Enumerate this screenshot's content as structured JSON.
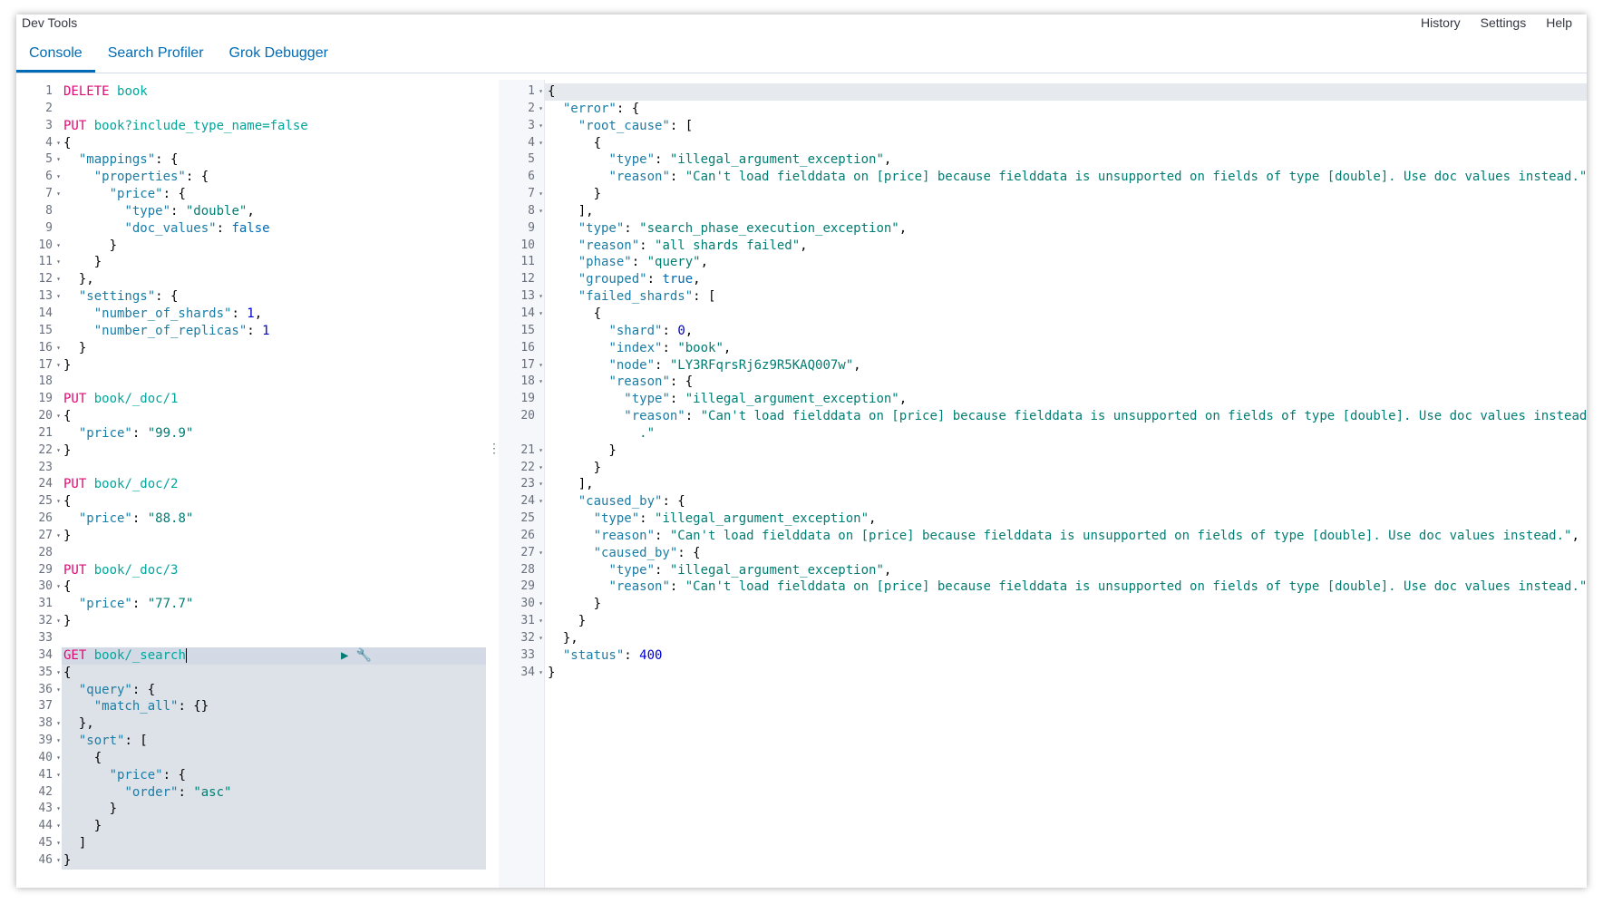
{
  "app_title": "Dev Tools",
  "top_links": [
    "History",
    "Settings",
    "Help"
  ],
  "tabs": [
    {
      "label": "Console",
      "active": true
    },
    {
      "label": "Search Profiler",
      "active": false
    },
    {
      "label": "Grok Debugger",
      "active": false
    }
  ],
  "colors": {
    "accent": "#006bb4",
    "method": "#dd0a73",
    "url": "#00a69b"
  },
  "editor": {
    "lines": [
      "DELETE book",
      "",
      "PUT book?include_type_name=false",
      "{",
      "  \"mappings\": {",
      "    \"properties\": {",
      "      \"price\": {",
      "        \"type\": \"double\",",
      "        \"doc_values\": false",
      "      }",
      "    }",
      "  },",
      "  \"settings\": {",
      "    \"number_of_shards\": 1,",
      "    \"number_of_replicas\": 1",
      "  }",
      "}",
      "",
      "PUT book/_doc/1",
      "{",
      "  \"price\": \"99.9\"",
      "}",
      "",
      "PUT book/_doc/2",
      "{",
      "  \"price\": \"88.8\"",
      "}",
      "",
      "PUT book/_doc/3",
      "{",
      "  \"price\": \"77.7\"",
      "}",
      "",
      "GET book/_search",
      "{",
      "  \"query\": {",
      "    \"match_all\": {}",
      "  },",
      "  \"sort\": [",
      "    {",
      "      \"price\": {",
      "        \"order\": \"asc\"",
      "      }",
      "    }",
      "  ]",
      "}"
    ],
    "fold_lines": [
      4,
      5,
      6,
      7,
      10,
      11,
      12,
      13,
      16,
      17,
      20,
      22,
      25,
      27,
      30,
      32,
      35,
      36,
      38,
      39,
      40,
      41,
      43,
      44,
      45,
      46
    ],
    "active_line": 34,
    "selected_range": [
      34,
      46
    ]
  },
  "output": {
    "lines": [
      "{",
      "  \"error\": {",
      "    \"root_cause\": [",
      "      {",
      "        \"type\": \"illegal_argument_exception\",",
      "        \"reason\": \"Can't load fielddata on [price] because fielddata is unsupported on fields of type [double]. Use doc values instead.\"",
      "      }",
      "    ],",
      "    \"type\": \"search_phase_execution_exception\",",
      "    \"reason\": \"all shards failed\",",
      "    \"phase\": \"query\",",
      "    \"grouped\": true,",
      "    \"failed_shards\": [",
      "      {",
      "        \"shard\": 0,",
      "        \"index\": \"book\",",
      "        \"node\": \"LY3RFqrsRj6z9R5KAQ007w\",",
      "        \"reason\": {",
      "          \"type\": \"illegal_argument_exception\",",
      "          \"reason\": \"Can't load fielddata on [price] because fielddata is unsupported on fields of type [double]. Use doc values instead",
      "        }",
      "      }",
      "    ],",
      "    \"caused_by\": {",
      "      \"type\": \"illegal_argument_exception\",",
      "      \"reason\": \"Can't load fielddata on [price] because fielddata is unsupported on fields of type [double]. Use doc values instead.\",",
      "      \"caused_by\": {",
      "        \"type\": \"illegal_argument_exception\",",
      "        \"reason\": \"Can't load fielddata on [price] because fielddata is unsupported on fields of type [double]. Use doc values instead.\"",
      "      }",
      "    }",
      "  },",
      "  \"status\": 400",
      "}"
    ],
    "wrap_after_line": 20,
    "wrap_text": "            .\"",
    "fold_lines": [
      1,
      2,
      3,
      4,
      7,
      8,
      13,
      14,
      17,
      18,
      21,
      22,
      23,
      24,
      27,
      30,
      31,
      32,
      34
    ],
    "active_line": 1
  }
}
